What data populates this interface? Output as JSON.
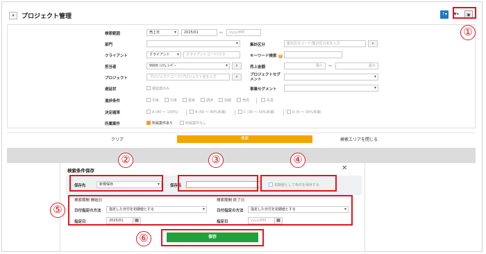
{
  "header": {
    "title": "プロジェクト管理",
    "collapse_icon": "▾",
    "upload_icon": "⇡▾",
    "filter_icon": "▼▾",
    "folder_icon": "▣"
  },
  "search": {
    "period": {
      "label": "検索範囲",
      "type": "売上日",
      "from": "2025/01",
      "tilde": "〜",
      "to_placeholder": "yyyy/MM"
    },
    "department": {
      "label": "部門"
    },
    "aggregate": {
      "label": "集計区分",
      "placeholder": "集計区分コード/集計区分名を入力"
    },
    "client": {
      "label": "クライアント",
      "type": "クライアント",
      "placeholder": "クライアントコード/クラ"
    },
    "keyword": {
      "label": "キーワード検索",
      "help": "?"
    },
    "owner": {
      "label": "担当者",
      "value": "9999 ｼｽﾃﾑ ﾕｰｻﾞｰ"
    },
    "sales_amount": {
      "label": "売上金額",
      "min_placeholder": "最小",
      "tilde": "〜",
      "max_placeholder": "最大"
    },
    "project": {
      "label": "プロジェクト",
      "placeholder": "プロジェクトコード/プロジェクト名を入力"
    },
    "project_segment": {
      "label": "プロジェクトセグメント"
    },
    "delay": {
      "label": "遅延状",
      "option": "遅延案のみ"
    },
    "business_segment": {
      "label": "事業セグメント"
    },
    "progress": {
      "label": "進捗条件",
      "options": [
        "引来",
        "引来",
        "受来",
        "請済",
        "完線",
        "売完",
        "失見"
      ]
    },
    "probability": {
      "label": "決定確率",
      "options": [
        "A (80 〜 100%)",
        "B (50 〜 80%未満)",
        "C (30 〜 50%未満)",
        "D (0 〜 30%未満)"
      ]
    },
    "affiliation": {
      "label": "所属案件",
      "options": [
        "所属案件あり",
        "所属案件なし"
      ]
    }
  },
  "actions": {
    "clear": "クリア",
    "search": "検索",
    "close_area": "検索エリアを閉じる"
  },
  "modal": {
    "title": "検索条件保存",
    "close": "✕",
    "save_to_label": "保存先",
    "save_to_value": "新規保存",
    "name_label": "保存名",
    "default_label": "初期値として条件を保存する",
    "start": {
      "heading": "検索期間 開始日",
      "method_label": "日付指定の方法",
      "method_value": "指定した日付を初期値とする",
      "date_label": "指定日",
      "date_value": "2025/01"
    },
    "end": {
      "heading": "検索期間 終了日",
      "method_label": "日付指定の方法",
      "method_value": "指定した日付を初期値とする",
      "date_label": "指定日",
      "date_placeholder": "yyyy/MM"
    },
    "save_button": "保存"
  },
  "callouts": [
    "①",
    "②",
    "③",
    "④",
    "⑤",
    "⑥"
  ],
  "colors": {
    "accent_orange": "#f5a300",
    "save_green": "#21a03c",
    "callout_red": "#e0141e",
    "primary_blue": "#1e78c8"
  }
}
